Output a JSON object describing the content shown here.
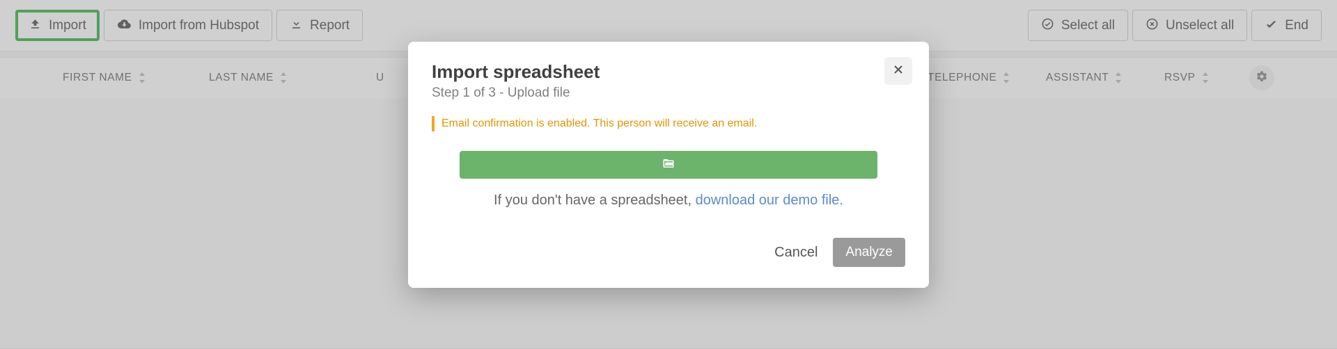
{
  "toolbar": {
    "import_label": "Import",
    "import_hubspot_label": "Import from Hubspot",
    "report_label": "Report",
    "select_all_label": "Select all",
    "unselect_all_label": "Unselect all",
    "end_label": "End"
  },
  "columns": {
    "first_name": "FIRST NAME",
    "last_name": "LAST NAME",
    "truncated": "U",
    "telephone": "TELEPHONE",
    "assistant": "ASSISTANT",
    "rsvp": "RSVP"
  },
  "modal": {
    "title": "Import spreadsheet",
    "subtitle": "Step 1 of 3 - Upload file",
    "warning": "Email confirmation is enabled. This person will receive an email.",
    "hint_prefix": "If you don't have a spreadsheet, ",
    "hint_link": "download our demo file.",
    "cancel_label": "Cancel",
    "analyze_label": "Analyze"
  }
}
